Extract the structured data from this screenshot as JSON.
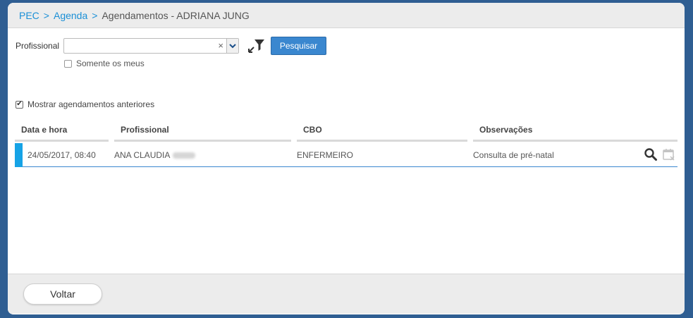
{
  "breadcrumb": {
    "items": [
      {
        "label": "PEC"
      },
      {
        "label": "Agenda"
      },
      {
        "label": "Agendamentos - ADRIANA JUNG"
      }
    ],
    "separator": ">"
  },
  "search": {
    "profissional_label": "Profissional",
    "profissional_value": "",
    "clear_glyph": "×",
    "search_button": "Pesquisar",
    "somente_os_meus": "Somente os meus",
    "somente_os_meus_checked": false
  },
  "mostrar_anteriores": {
    "label": "Mostrar agendamentos anteriores",
    "checked": true
  },
  "table": {
    "headers": [
      "Data e hora",
      "Profissional",
      "CBO",
      "Observações"
    ],
    "rows": [
      {
        "data_hora": "24/05/2017, 08:40",
        "profissional": "ANA CLAUDIA",
        "cbo": "ENFERMEIRO",
        "observacoes": "Consulta de pré-natal"
      }
    ]
  },
  "footer": {
    "back_button": "Voltar"
  },
  "icons": {
    "filter": "filter-icon",
    "view": "magnifier-icon",
    "cancel": "calendar-cancel-icon"
  },
  "colors": {
    "accent": "#3a87cf",
    "link": "#1a8fd6",
    "row_marker": "#16a3e6",
    "background": "#2f5e92"
  }
}
